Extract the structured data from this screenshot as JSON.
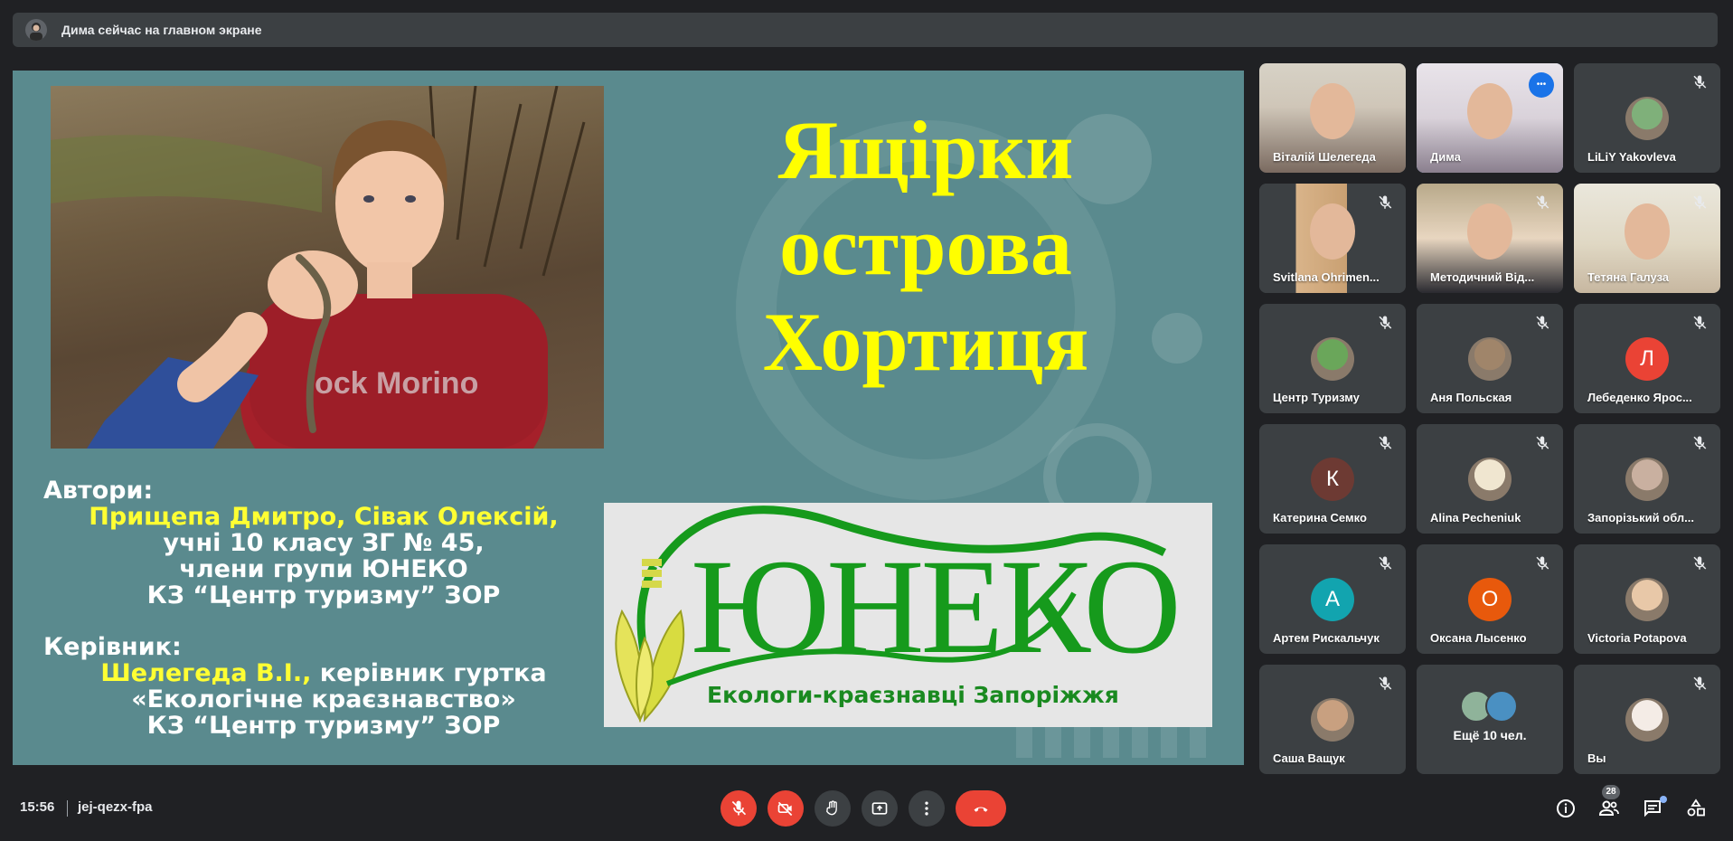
{
  "banner": {
    "text": "Дима сейчас на главном экране"
  },
  "slide": {
    "title_lines": [
      "Ящірки",
      "острова",
      "Хортиця"
    ],
    "authors_label": "Автори:",
    "authors_names": "Прищепа Дмитро, Сівак Олексій,",
    "authors_line2": "учні 10 класу ЗГ № 45,",
    "authors_line3": "члени групи ЮНЕКО",
    "authors_line4": "КЗ “Центр туризму” ЗОР",
    "leader_label": "Керівник:",
    "leader_name": "Шелегеда В.І.,",
    "leader_role": " керівник гуртка",
    "leader_line2": "«Екологічне краєзнавство»",
    "leader_line3": "КЗ “Центр туризму” ЗОР",
    "logo_text": "ЮНЕКО",
    "logo_sub": "Екологи-краєзнавці Запоріжжя",
    "photo_shirt_text": "ock Morino"
  },
  "participants": [
    {
      "name": "Віталій Шелегеда",
      "type": "video"
    },
    {
      "name": "Дима",
      "type": "video",
      "active": true
    },
    {
      "name": "LiLiY Yakovleva",
      "type": "avatar",
      "muted": true
    },
    {
      "name": "Svitlana Ohrimen...",
      "type": "video",
      "muted": true
    },
    {
      "name": "Методичний Від...",
      "type": "video",
      "muted": true
    },
    {
      "name": "Тетяна Галуза",
      "type": "video",
      "muted": true
    },
    {
      "name": "Центр Туризму",
      "type": "avatar",
      "muted": true
    },
    {
      "name": "Аня Польская",
      "type": "avatar",
      "muted": true
    },
    {
      "name": "Лебеденко Ярос...",
      "type": "letter",
      "letter": "Л",
      "color": "#ea4335",
      "muted": true
    },
    {
      "name": "Катерина Семко",
      "type": "letter",
      "letter": "К",
      "color": "#6d3a33",
      "muted": true
    },
    {
      "name": "Alina Pecheniuk",
      "type": "avatar",
      "muted": true
    },
    {
      "name": "Запорізький обл...",
      "type": "avatar",
      "muted": true
    },
    {
      "name": "Артем Рискальчук",
      "type": "letter",
      "letter": "А",
      "color": "#12a4af",
      "muted": true
    },
    {
      "name": "Оксана Лысенко",
      "type": "letter",
      "letter": "О",
      "color": "#e8590c",
      "muted": true
    },
    {
      "name": "Victoria Potapova",
      "type": "avatar",
      "muted": true
    },
    {
      "name": "Саша Ващук",
      "type": "avatar",
      "muted": true
    },
    {
      "name": "Ещё 10 чел.",
      "type": "more"
    },
    {
      "name": "Вы",
      "type": "avatar",
      "muted": true
    }
  ],
  "bottom": {
    "time": "15:56",
    "meeting_code": "jej-qezx-fpa",
    "participants_count": "28"
  },
  "icons": [
    "mic-off-icon",
    "camera-off-icon",
    "raise-hand-icon",
    "present-icon",
    "more-options-icon",
    "end-call-icon",
    "info-icon",
    "people-icon",
    "chat-icon",
    "activities-icon"
  ],
  "colors": {
    "background": "#202124",
    "tile": "#3c4043",
    "danger": "#ea4335",
    "slide_bg": "#5a8a8e",
    "slide_title": "#ffff00",
    "accent": "#8ab4f8"
  }
}
